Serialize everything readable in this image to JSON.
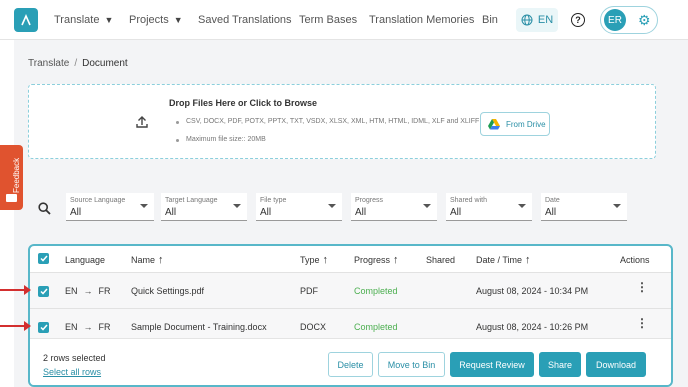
{
  "nav": {
    "items": [
      {
        "label": "Translate",
        "has_menu": true
      },
      {
        "label": "Projects",
        "has_menu": true
      },
      {
        "label": "Saved Translations",
        "has_menu": false
      },
      {
        "label": "Term Bases",
        "has_menu": false
      },
      {
        "label": "Translation Memories",
        "has_menu": false
      },
      {
        "label": "Bin",
        "has_menu": false
      }
    ],
    "language": "EN",
    "user_initials": "ER"
  },
  "breadcrumb": {
    "root": "Translate",
    "separator": "/",
    "current": "Document"
  },
  "upload": {
    "title": "Drop Files Here or Click to Browse",
    "formats": "CSV, DOCX, PDF, POTX, PPTX, TXT, VSDX, XLSX, XML, HTM, HTML, IDML, XLF and XLIFF",
    "max_size": "Maximum file size:: 20MB",
    "drive_button": "From Drive"
  },
  "feedback_label": "Feedback",
  "filters": [
    {
      "label": "Source Language",
      "value": "All"
    },
    {
      "label": "Target Language",
      "value": "All"
    },
    {
      "label": "File type",
      "value": "All"
    },
    {
      "label": "Progress",
      "value": "All"
    },
    {
      "label": "Shared with",
      "value": "All"
    },
    {
      "label": "Date",
      "value": "All"
    }
  ],
  "table": {
    "headers": {
      "language": "Language",
      "name": "Name",
      "type": "Type",
      "progress": "Progress",
      "shared": "Shared",
      "date": "Date / Time",
      "actions": "Actions"
    },
    "rows": [
      {
        "src": "EN",
        "tgt": "FR",
        "name": "Quick Settings.pdf",
        "type": "PDF",
        "progress": "Completed",
        "shared": "",
        "date": "August 08, 2024 - 10:34 PM",
        "checked": true
      },
      {
        "src": "EN",
        "tgt": "FR",
        "name": "Sample Document - Training.docx",
        "type": "DOCX",
        "progress": "Completed",
        "shared": "",
        "date": "August 08, 2024 - 10:26 PM",
        "checked": true
      }
    ]
  },
  "footer": {
    "selected": "2 rows selected",
    "select_all": "Select all rows",
    "buttons": {
      "delete": "Delete",
      "move": "Move to Bin",
      "review": "Request Review",
      "share": "Share",
      "download": "Download"
    }
  },
  "colors": {
    "accent": "#2a9fb6",
    "completed": "#4caf50",
    "feedback": "#e0532f",
    "annotation_arrow": "#d32f2f"
  }
}
